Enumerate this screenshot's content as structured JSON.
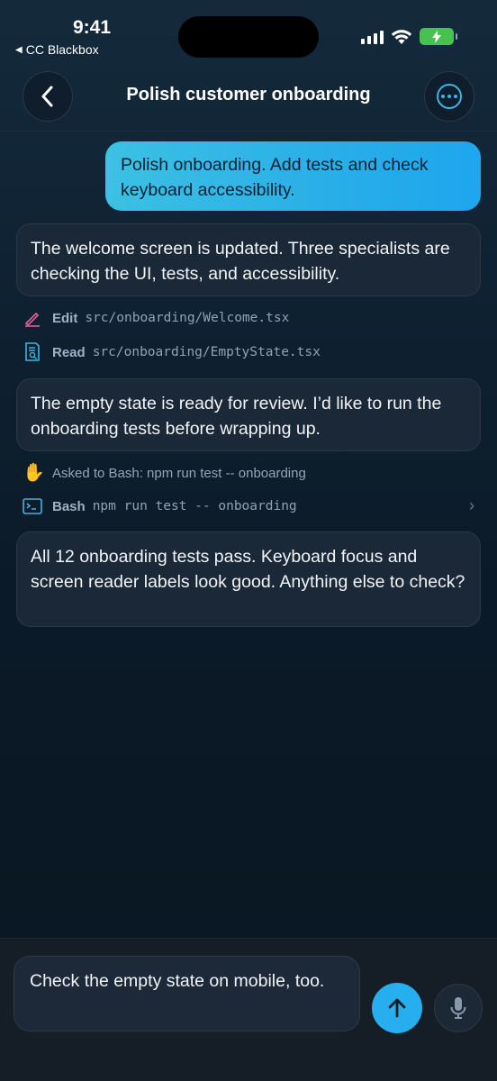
{
  "status_bar": {
    "time": "9:41",
    "back_app": "CC Blackbox",
    "back_icon": "triangle-left-icon",
    "battery_color": "#47c24f"
  },
  "header": {
    "title": "Polish customer onboarding",
    "back_icon": "chevron-left-icon",
    "more_icon": "ellipsis-circle-icon",
    "accent": "#38b6ea"
  },
  "messages": [
    {
      "role": "user",
      "text": "Polish onboarding. Add tests and check keyboard accessibility."
    },
    {
      "role": "assistant",
      "text": "The welcome screen is updated. Three specialists are checking the UI, tests, and accessibility."
    },
    {
      "role": "tool",
      "label": "Edit",
      "path": "src/onboarding/Welcome.tsx",
      "icon": "pencil-icon",
      "color": "#e0609a"
    },
    {
      "role": "tool",
      "label": "Read",
      "path": "src/onboarding/EmptyState.tsx",
      "icon": "document-search-icon",
      "color": "#3bb5e0"
    },
    {
      "role": "assistant",
      "text": "The empty state is ready for review. I’d like to run the onboarding tests before wrapping up."
    },
    {
      "role": "permission",
      "text": "Asked to Bash: npm run test -- onboarding",
      "icon": "raised-hand-icon"
    },
    {
      "role": "tool",
      "label": "Bash",
      "path": "npm run test -- onboarding",
      "icon": "terminal-icon",
      "color": "#3bb5e0"
    },
    {
      "role": "assistant",
      "text": "All 12 onboarding tests pass. Keyboard focus and screen reader labels look good. Anything else to check?"
    }
  ],
  "composer": {
    "value": "Check the empty state on mobile, too.",
    "send_icon": "arrow-up-icon",
    "mic_icon": "microphone-icon",
    "send_color": "#27aeee"
  }
}
